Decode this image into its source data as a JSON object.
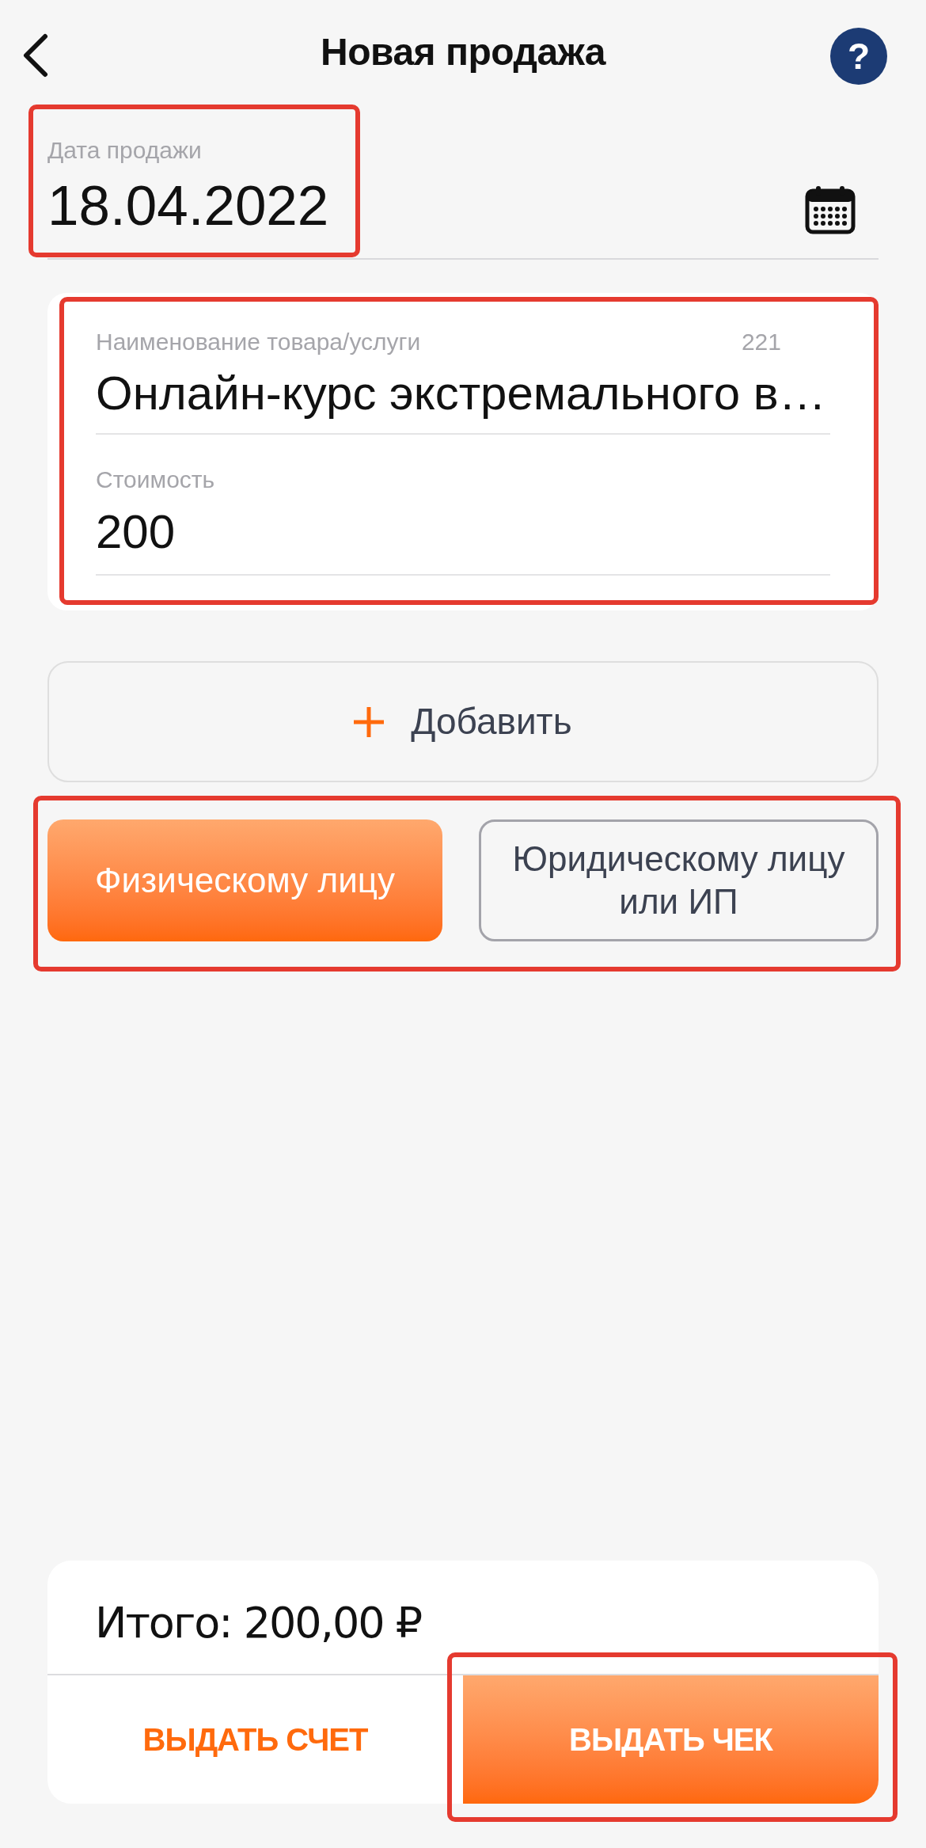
{
  "header": {
    "title": "Новая продажа",
    "help_button": {
      "label": "?"
    }
  },
  "date_field": {
    "label": "Дата продажи",
    "value": "18.04.2022",
    "highlighted": true
  },
  "items": [
    {
      "name_field": {
        "label": "Наименование товара/услуги",
        "counter": "221",
        "value": "Онлайн-курс экстремального в…"
      },
      "price_field": {
        "label": "Стоимость",
        "value": "200"
      },
      "highlighted": true
    }
  ],
  "add_button": {
    "label": "Добавить"
  },
  "customer_type": {
    "highlighted": true,
    "options": [
      {
        "label": "Физическому лицу",
        "selected": true
      },
      {
        "label": "Юридическому лицу или ИП",
        "selected": false
      }
    ]
  },
  "total": {
    "text": "Итого: 200,00 ₽"
  },
  "actions": [
    {
      "label": "ВЫДАТЬ СЧЕТ",
      "kind": "secondary"
    },
    {
      "label": "ВЫДАТЬ ЧЕК",
      "kind": "primary",
      "highlighted": true
    }
  ]
}
